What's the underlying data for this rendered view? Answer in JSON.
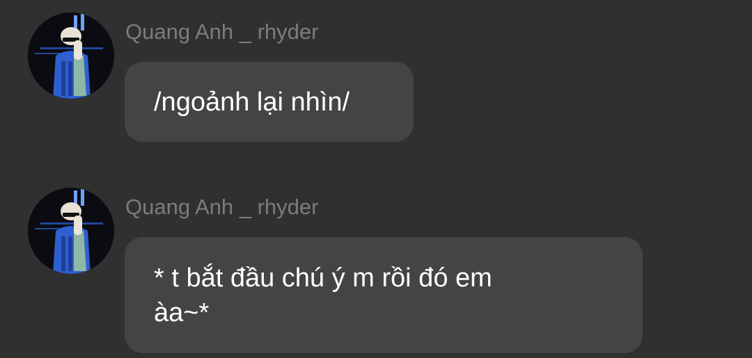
{
  "messages": [
    {
      "sender": "Quang Anh _ rhyder",
      "text": "/ngoảnh lại nhìn/"
    },
    {
      "sender": "Quang Anh _ rhyder",
      "text": "* t bắt đầu chú ý m rồi đó em\nàa~*"
    }
  ],
  "colors": {
    "background": "#303030",
    "bubble": "#444444",
    "sender_name": "#7c7c7c",
    "message_text": "#ffffff"
  },
  "icons": {
    "avatar": "user-avatar-photo"
  }
}
